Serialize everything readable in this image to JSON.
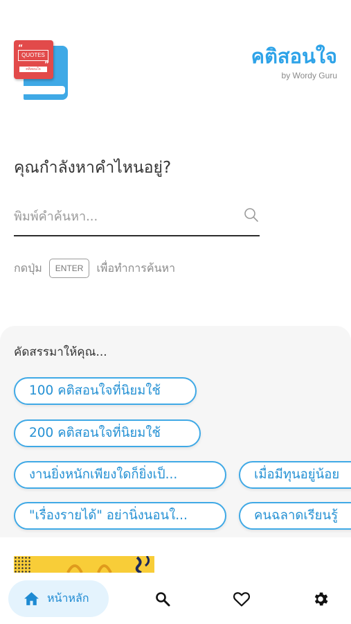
{
  "header": {
    "app_title": "คติสอนใจ",
    "app_subtitle": "by Wordy Guru",
    "logo": {
      "cover_text": "QUOTES",
      "strip_text": "คติสอนใจ",
      "icon": "quote-book-logo"
    }
  },
  "search": {
    "question": "คุณกำลังหาคำไหนอยู่?",
    "placeholder": "พิมพ์คำค้นหา...",
    "value": "",
    "hint_prefix": "กดปุ่ม",
    "hint_key": "ENTER",
    "hint_suffix": "เพื่อทำการค้นหา",
    "icon": "search-icon"
  },
  "recommend": {
    "title": "คัดสรรมาให้คุณ...",
    "chips": [
      "100 คติสอนใจที่นิยมใช้",
      "200 คติสอนใจที่นิยมใช้",
      "งานยิ่งหนักเพียงใดก็ยิ่งเป็...",
      "เมื่อมีทุนอยู่น้อย",
      "\"เรื่องรายได้\" อย่านิ่งนอนใ...",
      "คนฉลาดเรียนรู้"
    ]
  },
  "bottom_nav": {
    "home_label": "หน้าหลัก",
    "items": [
      "home-icon",
      "search-icon",
      "heart-icon",
      "gear-icon"
    ],
    "active": "home"
  },
  "colors": {
    "accent": "#2ea3e8",
    "chip_border": "#3fa9e6",
    "home_pill": "#e4f3fd",
    "logo_red": "#e24a4a",
    "banner_yellow": "#f8cd38"
  }
}
